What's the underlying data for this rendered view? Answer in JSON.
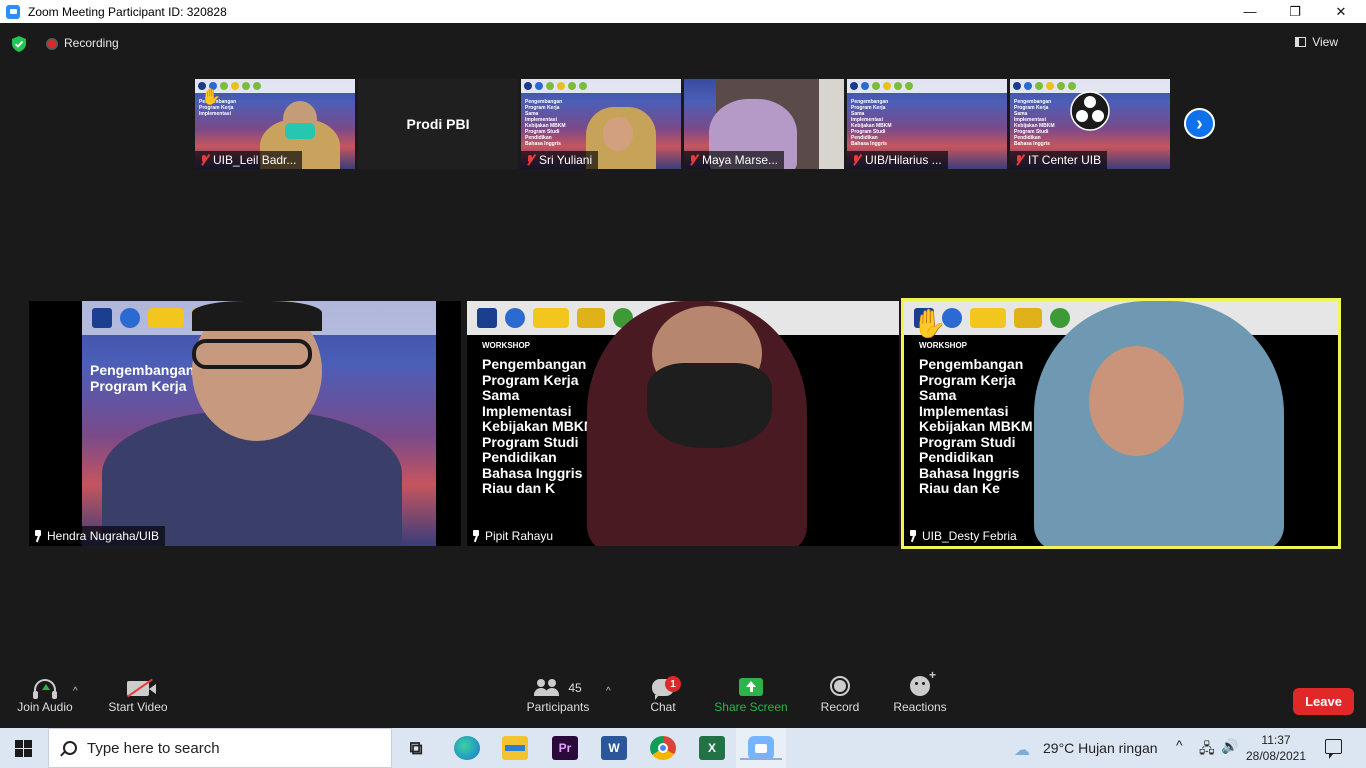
{
  "window": {
    "title": "Zoom Meeting Participant ID: 320828",
    "minimize": "—",
    "maximize": "❐",
    "close": "✕"
  },
  "topbar": {
    "recording_label": "Recording",
    "view_label": "View"
  },
  "thumbnails": [
    {
      "name": "UIB_Leil Badr...",
      "muted": true,
      "raised_hand": true
    },
    {
      "name": "Prodi PBI",
      "video": false
    },
    {
      "name": "Sri Yuliani",
      "muted": true
    },
    {
      "name": "Maya Marse...",
      "muted": true
    },
    {
      "name": "UIB/Hilarius ...",
      "muted": true
    },
    {
      "name": "IT Center UIB",
      "muted": true
    }
  ],
  "slide": {
    "workshop": "WORKSHOP",
    "lines": [
      "Pengembangan",
      "Program Kerja",
      "Sama",
      "Implementasi",
      "Kebijakan MBKM",
      "Program Studi",
      "Pendidikan",
      "Bahasa Inggris",
      "Riau dan Kepri"
    ]
  },
  "tiles": [
    {
      "name": "Hendra Nugraha/UIB",
      "slide_lines": [
        "Pengembangan",
        "Program Kerja"
      ]
    },
    {
      "name": "Pipit Rahayu",
      "slide_lines": [
        "Pengembangan",
        "Program Kerja",
        "Sama",
        "Implementasi",
        "Kebijakan MBKM",
        "Program Studi",
        "Pendidikan",
        "Bahasa Inggris",
        "Riau dan K"
      ]
    },
    {
      "name": "UIB_Desty Febria",
      "active_speaker": true,
      "slide_lines": [
        "Pengembangan",
        "Program Kerja",
        "Sama",
        "Implementasi",
        "Kebijakan MBKM",
        "Program Studi",
        "Pendidikan",
        "Bahasa Inggris",
        "Riau dan Ke"
      ]
    }
  ],
  "toolbar": {
    "join_audio": "Join Audio",
    "start_video": "Start Video",
    "participants": "Participants",
    "participant_count": "45",
    "chat": "Chat",
    "chat_badge": "1",
    "share_screen": "Share Screen",
    "record": "Record",
    "reactions": "Reactions",
    "leave": "Leave"
  },
  "taskbar": {
    "search_placeholder": "Type here to search",
    "weather": "29°C  Hujan ringan",
    "time": "11:37",
    "date": "28/08/2021",
    "apps": [
      "task-view",
      "edge",
      "file-explorer",
      "premiere-pro",
      "word",
      "chrome",
      "excel",
      "zoom"
    ]
  },
  "colors": {
    "zoom_blue": "#0e72ed",
    "leave_red": "#e02828",
    "share_green": "#2db34a",
    "active_speaker": "#f2f25a"
  }
}
